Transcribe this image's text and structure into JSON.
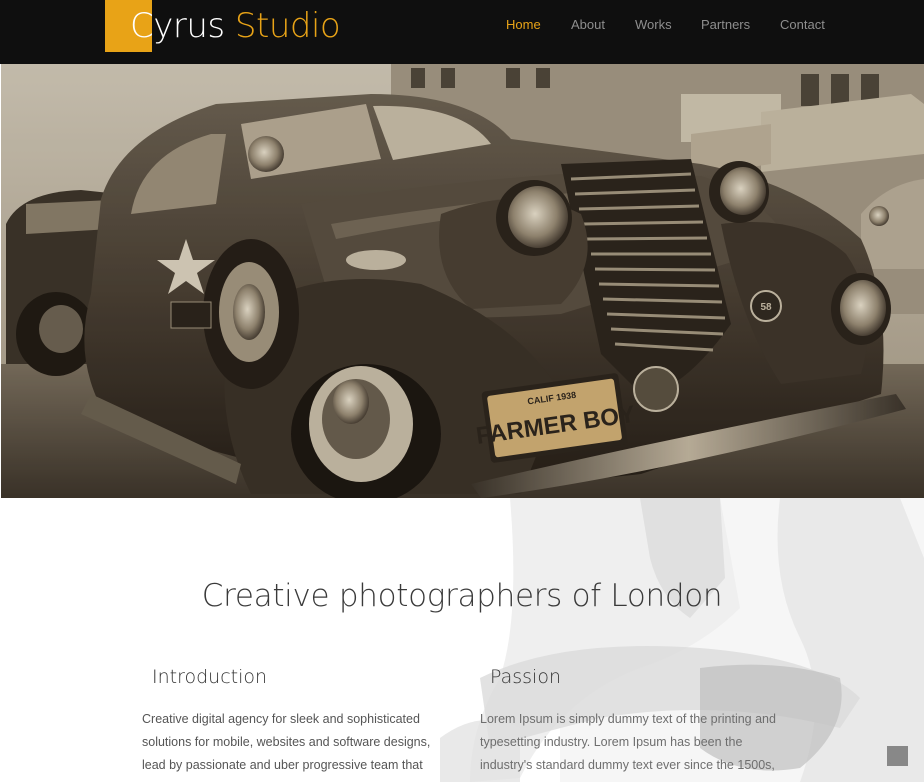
{
  "brand": {
    "word1": "Cyrus",
    "word2": "Studio",
    "accent_color": "#e8a317"
  },
  "nav": {
    "items": [
      {
        "label": "Home",
        "active": true
      },
      {
        "label": "About",
        "active": false
      },
      {
        "label": "Works",
        "active": false
      },
      {
        "label": "Partners",
        "active": false
      },
      {
        "label": "Contact",
        "active": false
      }
    ]
  },
  "hero": {
    "plate_line1": "CALIF 1938",
    "plate_line2": "FARMER BOY",
    "badge": "58"
  },
  "main": {
    "headline": "Creative photographers of London",
    "columns": [
      {
        "title": "Introduction",
        "text": "Creative digital agency for sleek and sophisticated solutions for mobile, websites and software designs, lead by passionate and uber progressive team that lives and breathes design. Creative digital agency for"
      },
      {
        "title": "Passion",
        "text": "Lorem Ipsum is simply dummy text of the printing and typesetting industry. Lorem Ipsum has been the industry's standard dummy text ever since the 1500s, when an unknown printer took a galley of type and"
      }
    ]
  },
  "icons": {
    "scroll_top": "scroll-to-top-icon"
  }
}
